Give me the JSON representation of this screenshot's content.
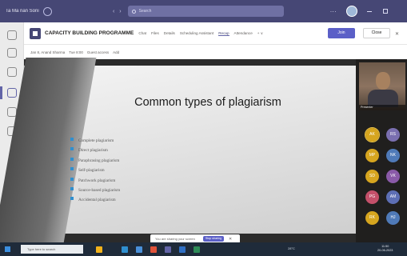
{
  "window": {
    "title": "Ta Ma nan Soni",
    "search_placeholder": "Search",
    "nav": "‹ ›",
    "more": "···",
    "minimize_icon": "minimize-icon",
    "maximize_icon": "maximize-icon"
  },
  "meeting": {
    "title": "CAPACITY BUILDING PROGRAMME",
    "tabs": [
      {
        "label": "Chat"
      },
      {
        "label": "Files"
      },
      {
        "label": "Details"
      },
      {
        "label": "Scheduling Assistant"
      },
      {
        "label": "Recap"
      },
      {
        "label": "Attendance"
      },
      {
        "label": "+ ∨"
      }
    ],
    "active_tab_index": 4,
    "join_label": "Join",
    "close_label": "Close"
  },
  "subheader": {
    "items": [
      "Jan 8, Anand Sharma",
      "Tue 8:00",
      "Guest access",
      "Add"
    ]
  },
  "slide": {
    "title": "Common types of plagiarism",
    "bullets": [
      "Complete plagiarism",
      "Direct plagiarism",
      "Paraphrasing plagiarism",
      "Self-plagiarism",
      "Patchwork plagiarism",
      "Source-based plagiarism",
      "Accidental plagiarism"
    ],
    "bullet_color": "#2f8fcf"
  },
  "share_bar": {
    "text": "You are sharing your screen",
    "stop_label": "Stop sharing"
  },
  "participants": {
    "camera_name": "Presenter",
    "avatars": [
      {
        "initials": "AK",
        "color": "#d6a51f"
      },
      {
        "initials": "RS",
        "color": "#7a6fb0"
      },
      {
        "initials": "MP",
        "color": "#d6a51f"
      },
      {
        "initials": "NK",
        "color": "#4f7ab8"
      },
      {
        "initials": "SD",
        "color": "#d6a51f"
      },
      {
        "initials": "VK",
        "color": "#8a5aa8"
      },
      {
        "initials": "PG",
        "color": "#c4506a"
      },
      {
        "initials": "AM",
        "color": "#5d6fb5"
      },
      {
        "initials": "RK",
        "color": "#d6a51f"
      },
      {
        "initials": "HJ",
        "color": "#4f7ab8"
      }
    ]
  },
  "taskbar": {
    "search_placeholder": "Type here to search",
    "tray_text": "28°C",
    "time": "11:50",
    "date": "20-06-2023",
    "apps": [
      {
        "icon": "files-icon",
        "color": "#f2b21b"
      },
      {
        "icon": "edge-icon",
        "color": "#2f8fcf"
      },
      {
        "icon": "mail-icon",
        "color": "#4a90d9"
      },
      {
        "icon": "chrome-icon",
        "color": "#e0533a"
      },
      {
        "icon": "teams-icon",
        "color": "#6264a7"
      },
      {
        "icon": "word-icon",
        "color": "#2f6fc4"
      },
      {
        "icon": "excel-icon",
        "color": "#2e8b57"
      }
    ]
  }
}
